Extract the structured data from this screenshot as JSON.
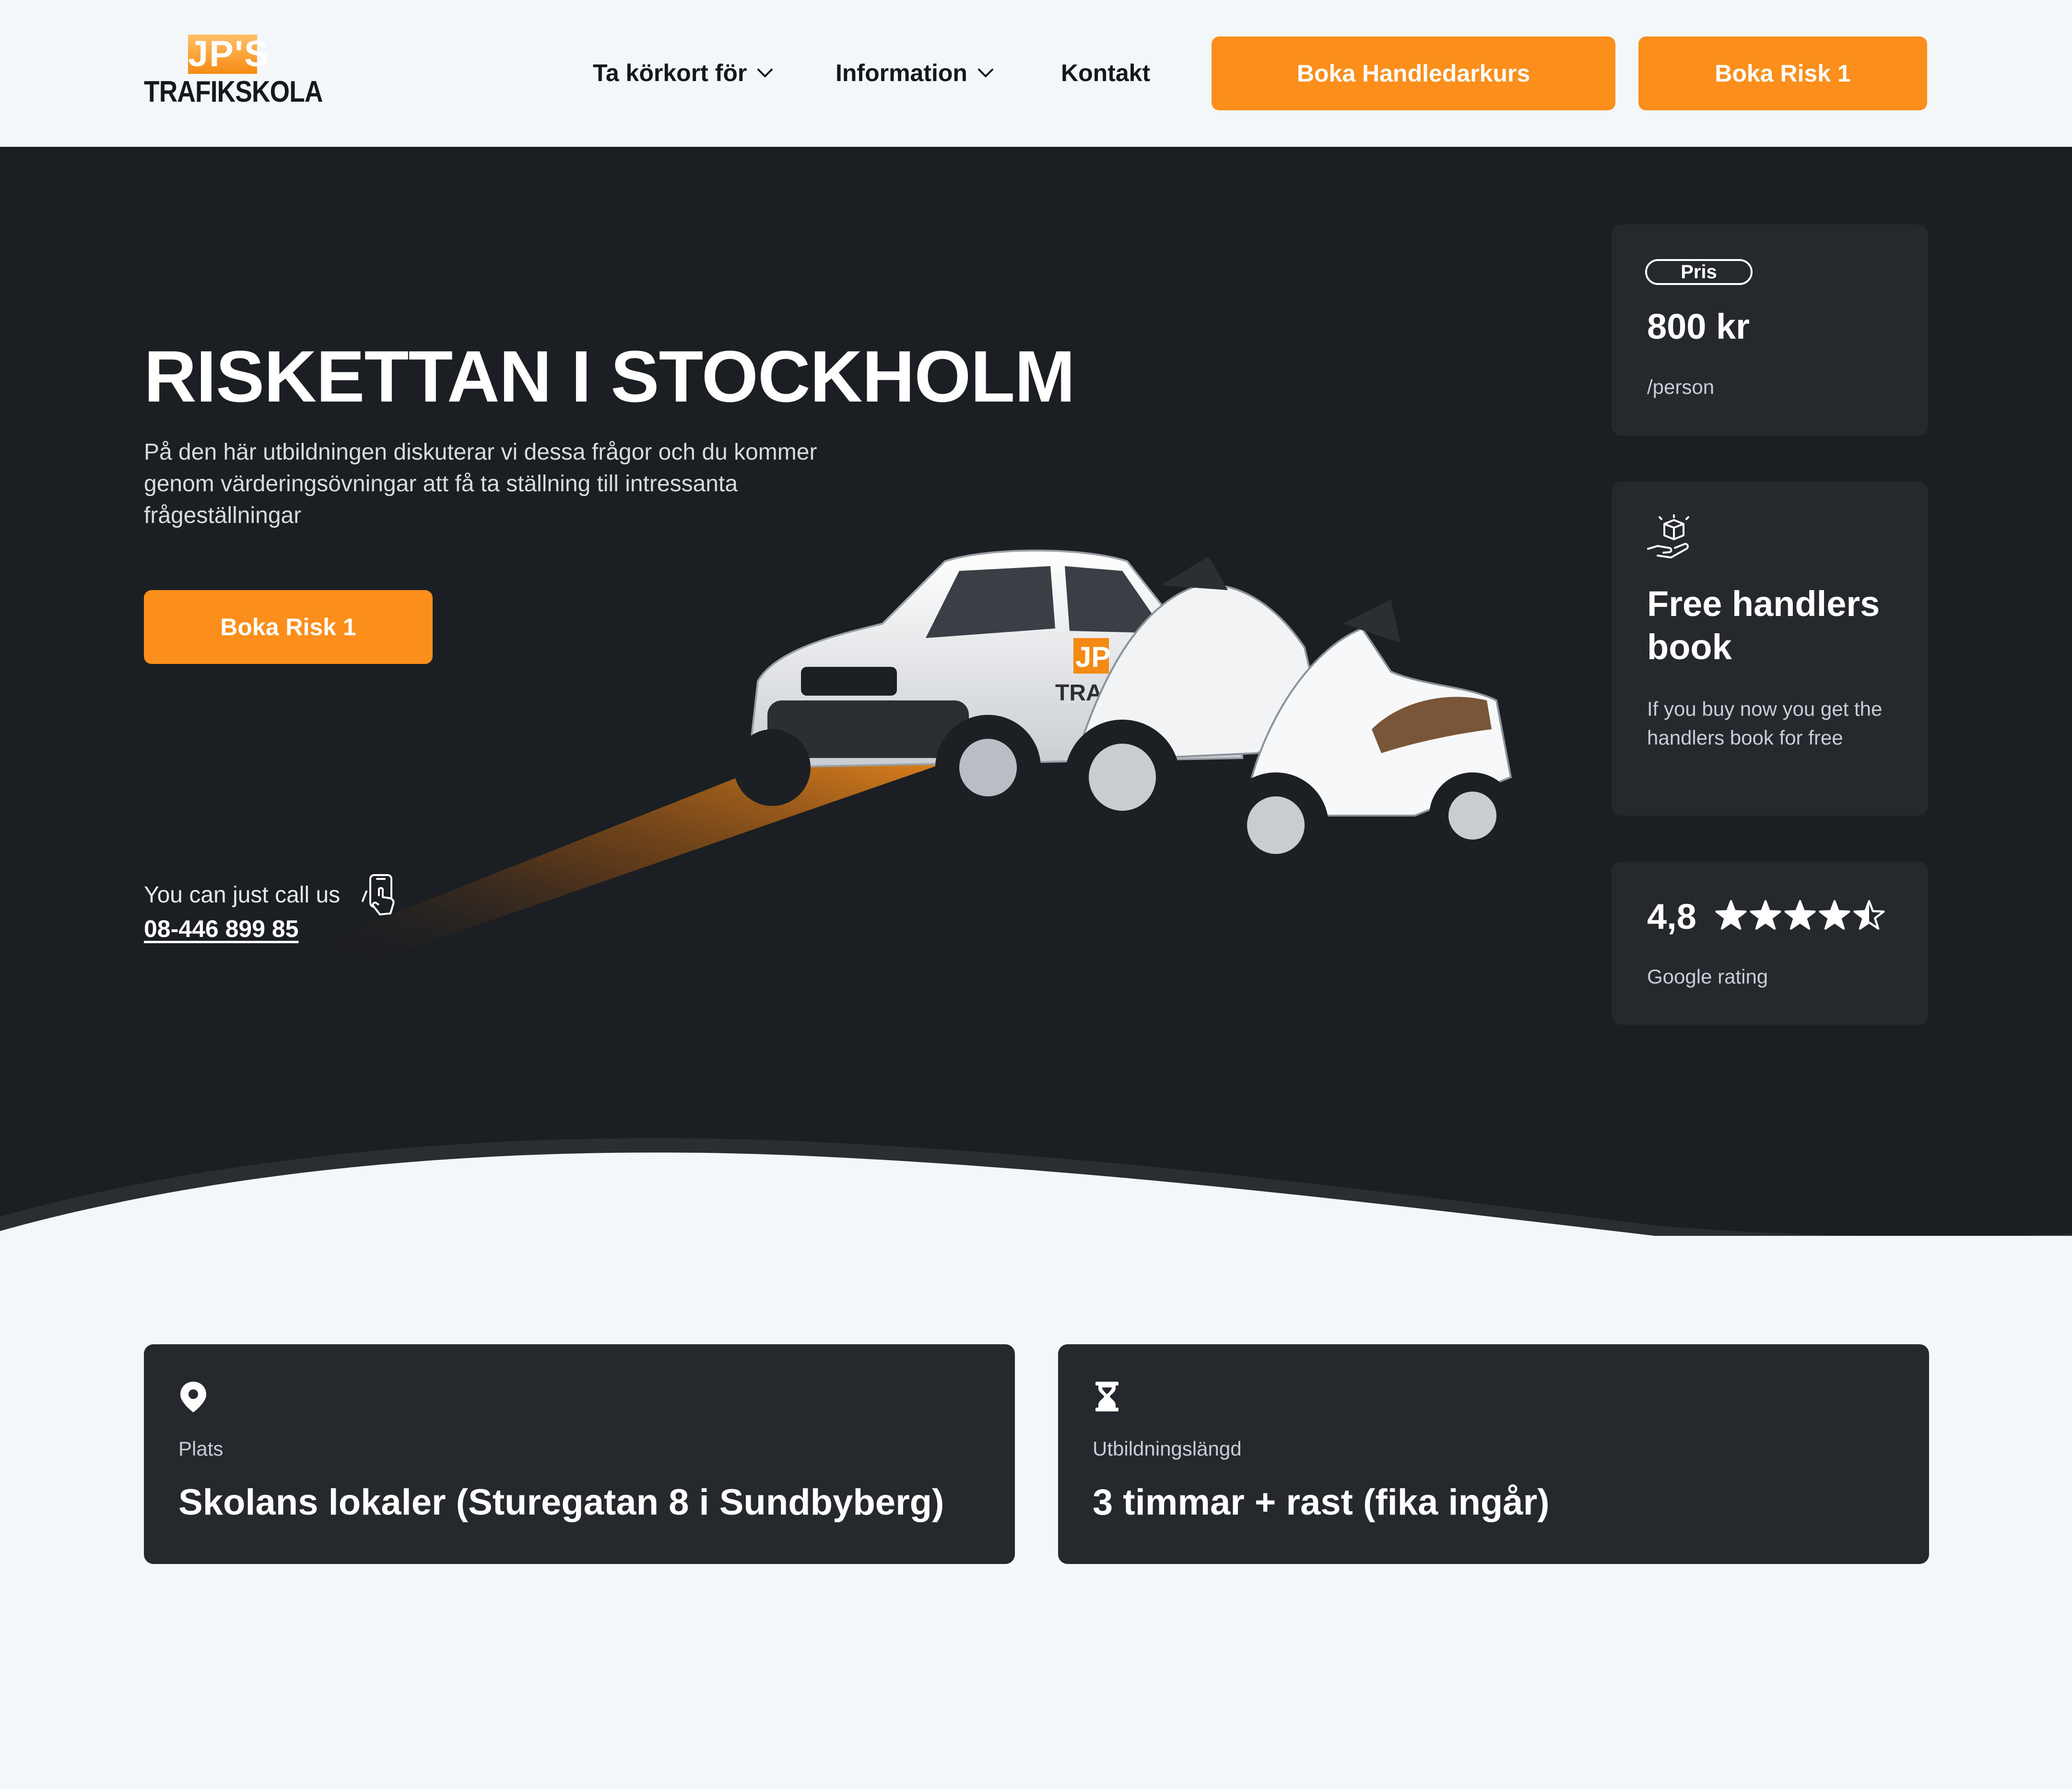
{
  "header": {
    "logo_top": "JP'S",
    "logo_bottom": "TRAFIKSKOLA",
    "nav": {
      "item1": "Ta körkort för",
      "item2": "Information",
      "item3": "Kontakt"
    },
    "btn_handledarkurs": "Boka Handledarkurs",
    "btn_risk1": "Boka Risk 1"
  },
  "hero": {
    "title": "RISKETTAN I STOCKHOLM",
    "description": "På den här utbildningen diskuterar vi dessa frågor och du kommer genom värderingsövningar att få ta ställning till intressanta frågeställningar",
    "cta": "Boka Risk 1",
    "call_label": "You can just call us",
    "phone": "08-446 899 85",
    "vehicle_badge": "JP",
    "vehicle_text": "TRAFIK"
  },
  "price_card": {
    "badge": "Pris",
    "price": "800 kr",
    "unit": "/person"
  },
  "free_card": {
    "title": "Free handlers book",
    "description": "If you buy now you get the handlers book for free"
  },
  "rating_card": {
    "value": "4,8",
    "stars": 4.5,
    "label": "Google rating"
  },
  "info": {
    "place_label": "Plats",
    "place_value": "Skolans lokaler (Sturegatan 8 i Sundbyberg)",
    "duration_label": "Utbildningslängd",
    "duration_value": "3 timmar + rast (fika ingår)"
  },
  "colors": {
    "accent": "#fc8f1b",
    "dark_bg": "#1b1e22",
    "card_bg": "#25292e",
    "page_bg": "#f4f7fa"
  },
  "icons": {
    "nav_dropdown": "chevron-down-icon",
    "free_card": "hand-box-icon",
    "call": "phone-tap-icon",
    "place": "location-pin-icon",
    "duration": "hourglass-icon",
    "rating": "star-icon"
  }
}
